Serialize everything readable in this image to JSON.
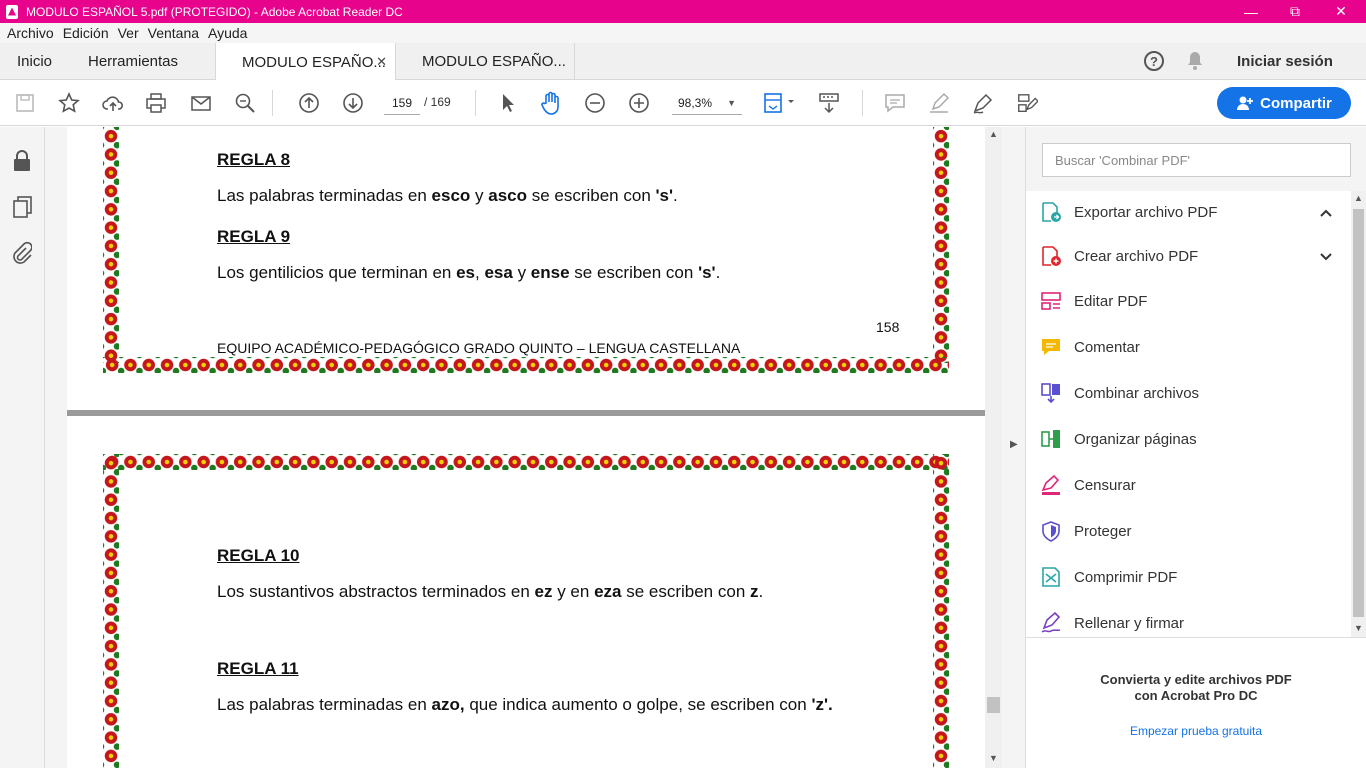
{
  "window": {
    "title": "MODULO ESPAÑOL 5.pdf (PROTEGIDO) - Adobe Acrobat Reader DC"
  },
  "menu": [
    "Archivo",
    "Edición",
    "Ver",
    "Ventana",
    "Ayuda"
  ],
  "tabs": {
    "home": "Inicio",
    "tools": "Herramientas",
    "doc1": "MODULO ESPAÑO...",
    "doc2": "MODULO ESPAÑO..."
  },
  "header": {
    "signin": "Iniciar sesión"
  },
  "toolbar": {
    "page_current": "159",
    "page_total": "/  169",
    "zoom": "98,3%",
    "share_label": "Compartir"
  },
  "document": {
    "page1": {
      "rule8_title": "REGLA 8",
      "rule8_text": [
        "Las palabras terminadas en ",
        "esco",
        " y ",
        "asco",
        " se escriben con ",
        "'s'",
        "."
      ],
      "rule9_title": "REGLA 9",
      "rule9_text": [
        " Los gentilicios que terminan en ",
        "es",
        ", ",
        "esa",
        " y ",
        "ense",
        " se escriben con ",
        "'s'",
        "."
      ],
      "page_number": "158",
      "footer": "EQUIPO ACADÉMICO-PEDAGÓGICO GRADO QUINTO – LENGUA CASTELLANA"
    },
    "page2": {
      "rule10_title": "REGLA 10",
      "rule10_text": [
        "Los sustantivos abstractos terminados en ",
        "ez",
        " y en ",
        "eza",
        " se escriben con ",
        "z",
        "."
      ],
      "rule11_title": "REGLA 11",
      "rule11_text": [
        "Las palabras terminadas en ",
        "azo,",
        " que indica aumento o golpe, se escriben con ",
        "'z'."
      ]
    }
  },
  "right_panel": {
    "search_placeholder": "Buscar 'Combinar PDF'",
    "tools": [
      {
        "label": "Exportar archivo PDF",
        "icon": "export-pdf-icon",
        "color": "#2ba6a6"
      },
      {
        "label": "Crear archivo PDF",
        "icon": "create-pdf-icon",
        "color": "#e0262c"
      },
      {
        "label": "Editar PDF",
        "icon": "edit-pdf-icon",
        "color": "#e0267a"
      },
      {
        "label": "Comentar",
        "icon": "comment-icon",
        "color": "#f5b800"
      },
      {
        "label": "Combinar archivos",
        "icon": "combine-icon",
        "color": "#5a4fcf"
      },
      {
        "label": "Organizar páginas",
        "icon": "organize-icon",
        "color": "#2e9e4b"
      },
      {
        "label": "Censurar",
        "icon": "redact-icon",
        "color": "#e0267a"
      },
      {
        "label": "Proteger",
        "icon": "protect-icon",
        "color": "#5a4fcf"
      },
      {
        "label": "Comprimir PDF",
        "icon": "compress-icon",
        "color": "#2ba6a6"
      },
      {
        "label": "Rellenar y firmar",
        "icon": "fill-sign-icon",
        "color": "#7a3fbf"
      }
    ],
    "promo_line1": "Convierta y edite archivos PDF",
    "promo_line2": "con Acrobat Pro DC",
    "promo_link": "Empezar prueba gratuita"
  }
}
